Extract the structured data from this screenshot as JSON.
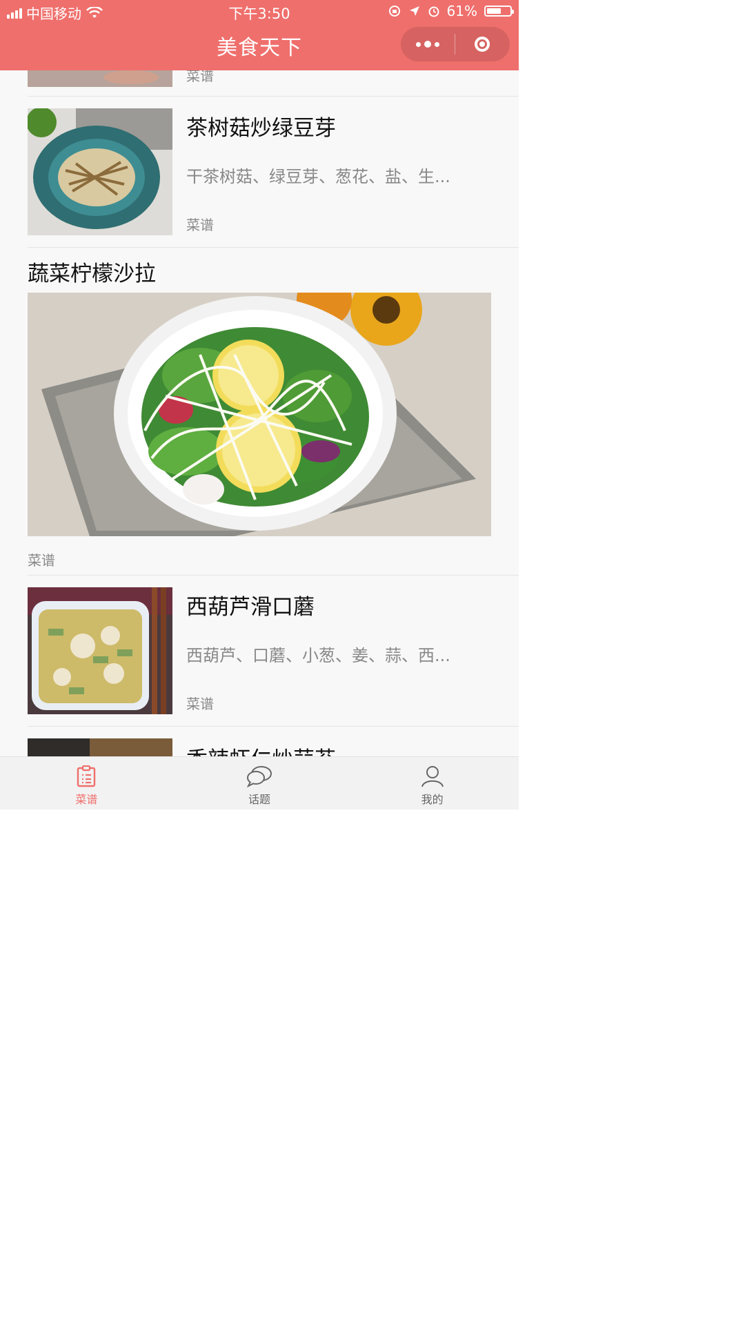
{
  "status_bar": {
    "carrier": "中国移动",
    "time": "下午3:50",
    "battery": "61%",
    "battery_level": 0.61
  },
  "nav": {
    "title": "美食天下",
    "more_icon": "more-dots-icon",
    "close_icon": "target-close-icon"
  },
  "feed": [
    {
      "type": "partial",
      "tag": "菜谱"
    },
    {
      "type": "small",
      "title": "茶树菇炒绿豆芽",
      "desc": "干茶树菇、绿豆芽、葱花、盐、生...",
      "tag": "菜谱"
    },
    {
      "type": "large",
      "title": "蔬菜柠檬沙拉",
      "tag": "菜谱"
    },
    {
      "type": "small",
      "title": "西葫芦滑口蘑",
      "desc": "西葫芦、口蘑、小葱、姜、蒜、西...",
      "tag": "菜谱"
    },
    {
      "type": "partial_bottom",
      "title": "香辣虾仁炒蒜苔"
    }
  ],
  "tabbar": [
    {
      "label": "菜谱",
      "icon": "clipboard-list-icon",
      "active": true
    },
    {
      "label": "话题",
      "icon": "chat-bubbles-icon",
      "active": false
    },
    {
      "label": "我的",
      "icon": "person-icon",
      "active": false
    }
  ],
  "colors": {
    "brand": "#ef6f6c",
    "page_bg": "#f8f8f8"
  }
}
